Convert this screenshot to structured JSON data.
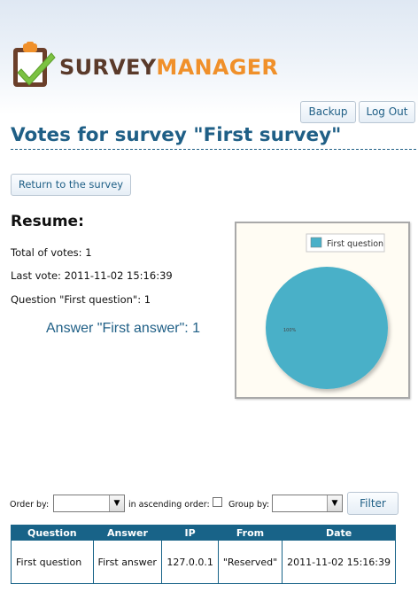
{
  "logo": {
    "text_part1": "SURVEY",
    "text_part2": "MANAGER",
    "icon": "clipboard-check-icon",
    "colors": {
      "part1": "#5a3a2a",
      "part2": "#f0902a",
      "check": "#7cc242"
    }
  },
  "header": {
    "backup_label": "Backup",
    "logout_label": "Log Out"
  },
  "page_title": "Votes for survey \"First survey\"",
  "return_label": "Return to the survey",
  "resume": {
    "heading": "Resume:",
    "total_votes": "Total of votes: 1",
    "last_vote": "Last vote: 2011-11-02 15:16:39",
    "question": "Question \"First question\": 1",
    "answer": "Answer \"First answer\": 1"
  },
  "chart_data": {
    "type": "pie",
    "categories": [
      "First question"
    ],
    "values": [
      100
    ],
    "slice_labels": [
      "100%"
    ],
    "legend": "top-right",
    "colors": [
      "#4ab0c8"
    ]
  },
  "filter": {
    "order_by_label": "Order by:",
    "order_by_value": "",
    "ascending_label": "in ascending order:",
    "ascending_checked": false,
    "group_by_label": "Group by:",
    "group_by_value": "",
    "button_label": "Filter"
  },
  "table": {
    "headers": [
      "Question",
      "Answer",
      "IP",
      "From",
      "Date"
    ],
    "rows": [
      [
        "First question",
        "First answer",
        "127.0.0.1",
        "\"Reserved\"",
        "2011-11-02 15:16:39"
      ]
    ]
  },
  "theme": {
    "accent": "#1f5f86",
    "table_header": "#186388"
  }
}
